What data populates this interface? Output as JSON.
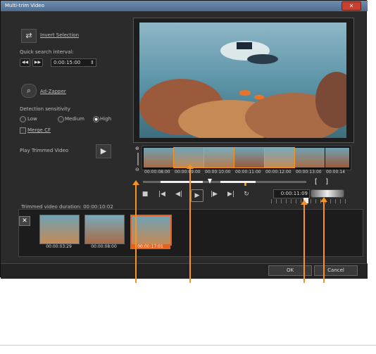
{
  "window": {
    "title": "Multi-trim Video",
    "close_icon": "close-icon"
  },
  "left": {
    "invert_selection": "Invert Selection",
    "quick_search_label": "Quick search interval:",
    "quick_search_value": "0:00:15:00",
    "ad_zapper": "Ad-Zapper",
    "detection_label": "Detection sensitivity",
    "sensitivity_options": [
      "Low",
      "Medium",
      "High"
    ],
    "sensitivity_selected": "High",
    "merge_cf": "Merge CF",
    "play_trimmed": "Play Trimmed Video"
  },
  "timeline": {
    "timecodes": [
      "00:00:08:00",
      "00:00:09:00",
      "00:00:10:00",
      "00:00:11:00",
      "00:00:12:00",
      "00:00:13:00",
      "00:00:14"
    ]
  },
  "transport": {
    "timecode": "0:00:11:09"
  },
  "trimmed": {
    "duration_label": "Trimmed video duration: 00:00:10:02",
    "clips": [
      "00:00:03:29",
      "00:00:08:00",
      "00:00:17:01"
    ]
  },
  "footer": {
    "ok": "OK",
    "cancel": "Cancel"
  },
  "colors": {
    "accent_orange": "#f7931e",
    "selected_clip_bg": "#e8601c"
  }
}
